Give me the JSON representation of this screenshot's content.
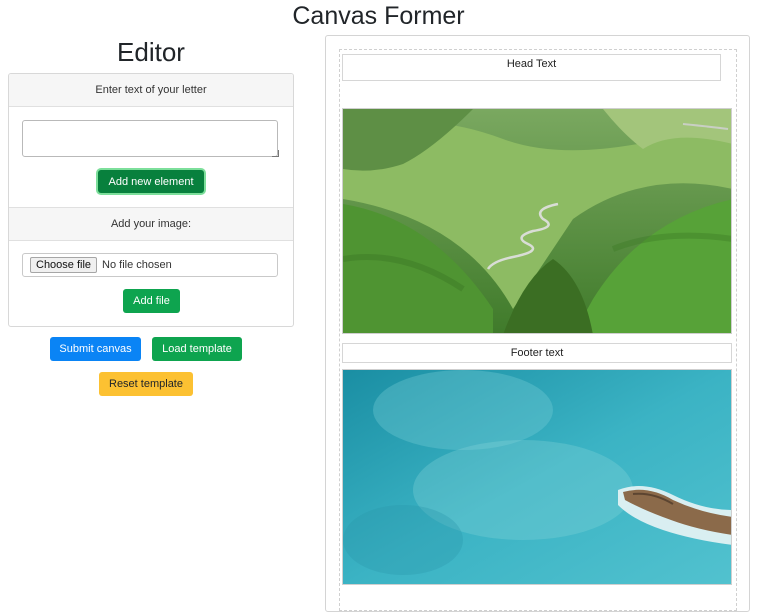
{
  "app": {
    "title": "Canvas Former"
  },
  "editor": {
    "title": "Editor",
    "text_section": {
      "header": "Enter text of your letter",
      "input_value": "",
      "add_button": "Add new element"
    },
    "image_section": {
      "header": "Add your image:",
      "choose_button": "Choose file",
      "file_status": "No file chosen",
      "add_button": "Add file"
    },
    "actions": {
      "submit": "Submit canvas",
      "load": "Load template",
      "reset": "Reset template"
    }
  },
  "canvas": {
    "elements": [
      {
        "kind": "text",
        "text": "Head Text"
      },
      {
        "kind": "image",
        "subject": "green-valley-winding-road-photo"
      },
      {
        "kind": "text",
        "text": "Footer text"
      },
      {
        "kind": "image",
        "subject": "turquoise-sea-rocky-coast-photo"
      }
    ]
  },
  "colors": {
    "primary": "#0a84f5",
    "success": "#0ea44f",
    "warning": "#fcc132"
  }
}
